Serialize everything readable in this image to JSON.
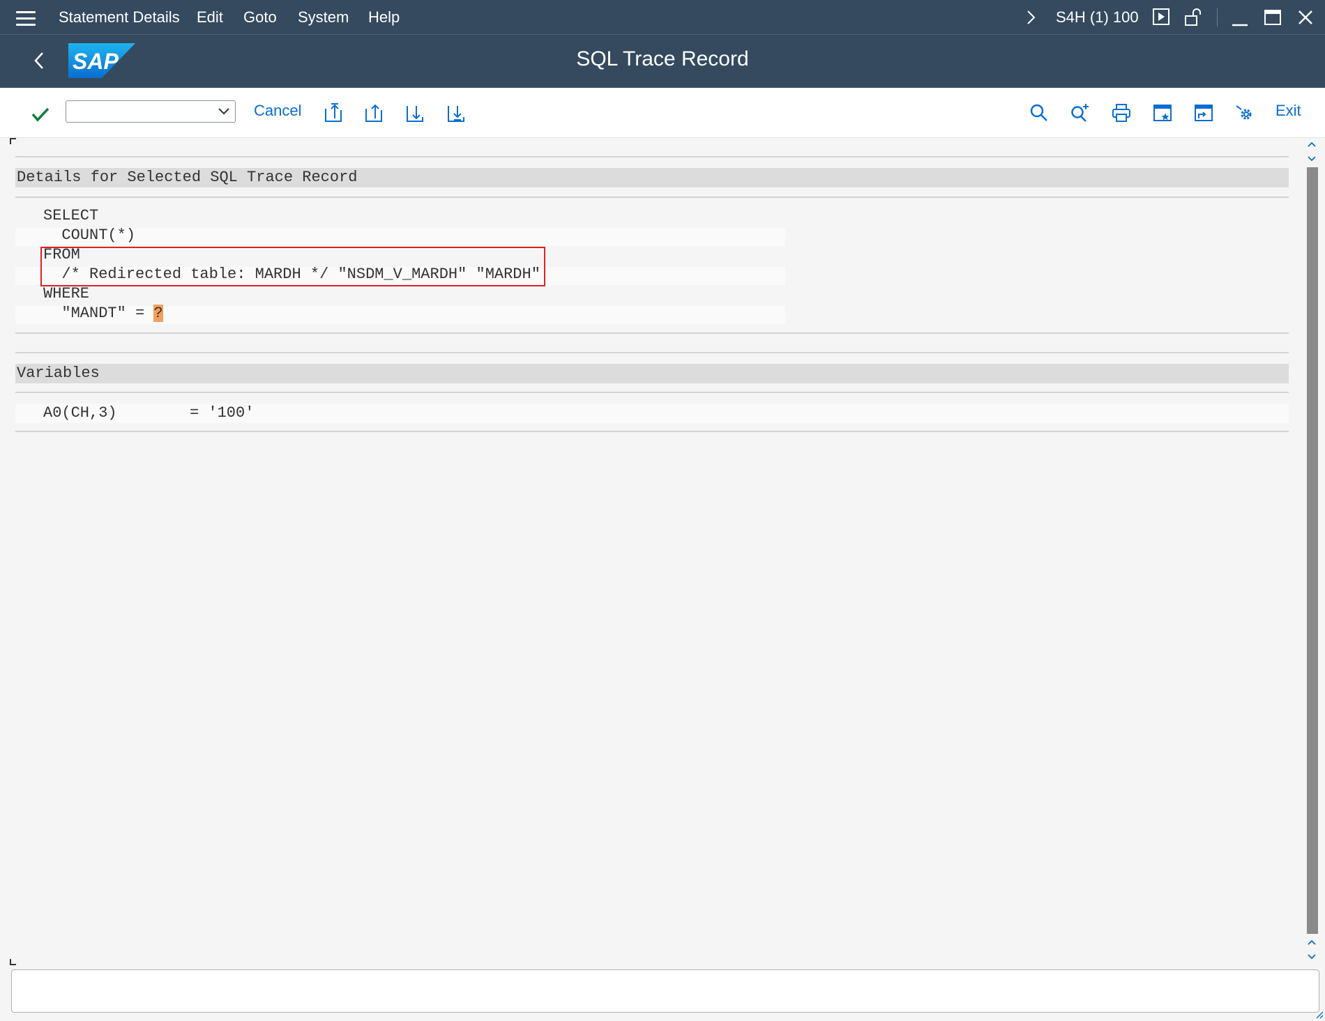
{
  "menubar": {
    "items": [
      "Statement Details",
      "Edit",
      "Goto",
      "System",
      "Help"
    ],
    "system_info": "S4H (1) 100"
  },
  "titlebar": {
    "logo": "SAP",
    "title": "SQL Trace Record"
  },
  "toolbar": {
    "command_field_value": "",
    "cancel_label": "Cancel",
    "exit_label": "Exit"
  },
  "details": {
    "header": "Details for Selected SQL Trace Record",
    "lines": [
      "SELECT",
      "  COUNT(*)",
      "FROM",
      "  /* Redirected table: MARDH */ \"NSDM_V_MARDH\" \"MARDH\"",
      "WHERE",
      "  \"MANDT\" = "
    ],
    "placeholder": "?"
  },
  "variables": {
    "header": "Variables",
    "rows": [
      {
        "name": "A0(CH,3)",
        "value": "= '100'"
      }
    ]
  },
  "colors": {
    "shell": "#354a5f",
    "accent": "#0a6ed1",
    "highlight_box": "#e02020",
    "placeholder_bg": "#f4a05c",
    "check": "#107e3e"
  },
  "icons": [
    "menu-icon",
    "chevron-right-icon",
    "play-icon",
    "unlock-icon",
    "minimize-icon",
    "maximize-icon",
    "close-icon",
    "back-icon",
    "check-icon",
    "first-page-icon",
    "previous-page-icon",
    "next-page-icon",
    "last-page-icon",
    "search-icon",
    "search-next-icon",
    "print-icon",
    "new-session-icon",
    "shortcut-icon",
    "settings-icon"
  ]
}
